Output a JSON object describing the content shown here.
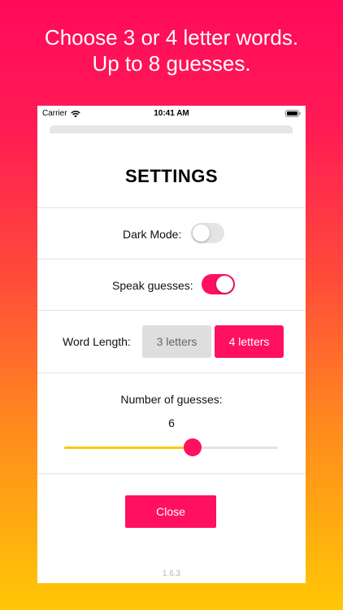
{
  "promo": {
    "line1": "Choose 3 or 4 letter words.",
    "line2": "Up to 8 guesses."
  },
  "status_bar": {
    "carrier": "Carrier",
    "time": "10:41 AM"
  },
  "settings": {
    "title": "SETTINGS",
    "dark_mode": {
      "label": "Dark Mode:",
      "enabled": false
    },
    "speak_guesses": {
      "label": "Speak guesses:",
      "enabled": true
    },
    "word_length": {
      "label": "Word Length:",
      "options": [
        "3 letters",
        "4 letters"
      ],
      "selected": "4 letters"
    },
    "guesses": {
      "label": "Number of guesses:",
      "value": "6",
      "min": 1,
      "max": 8
    },
    "close_label": "Close",
    "version": "1.6.3"
  },
  "colors": {
    "accent": "#ff1060",
    "slider_fill": "#ffc80a",
    "gradient_top": "#ff0a5a",
    "gradient_bottom": "#ffc805"
  }
}
